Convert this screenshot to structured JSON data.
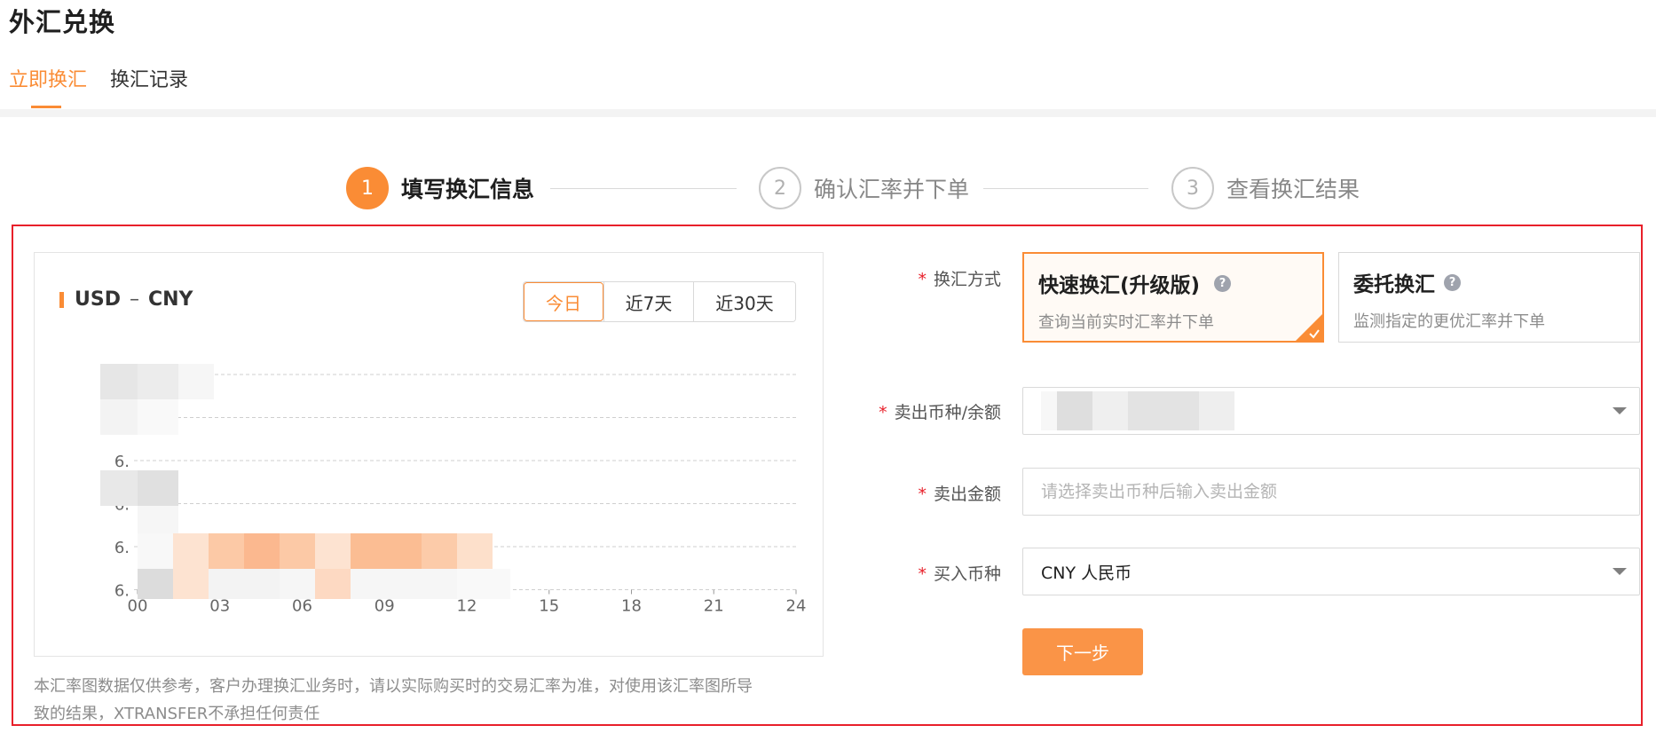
{
  "page": {
    "title": "外汇兑换"
  },
  "tabs": [
    {
      "label": "立即换汇",
      "active": true
    },
    {
      "label": "换汇记录",
      "active": false
    }
  ],
  "steps": [
    {
      "num": "1",
      "label": "填写换汇信息",
      "active": true
    },
    {
      "num": "2",
      "label": "确认汇率并下单",
      "active": false
    },
    {
      "num": "3",
      "label": "查看换汇结果",
      "active": false
    }
  ],
  "chart": {
    "pair_from": "USD",
    "pair_sep": "–",
    "pair_to": "CNY",
    "periods": [
      {
        "label": "今日",
        "active": true
      },
      {
        "label": "近7天",
        "active": false
      },
      {
        "label": "近30天",
        "active": false
      }
    ]
  },
  "chart_data": {
    "type": "line",
    "x_ticks": [
      "00",
      "03",
      "06",
      "09",
      "12",
      "15",
      "18",
      "21",
      "24"
    ],
    "y_ticks": [
      "6.",
      "6.",
      "6.",
      "6.",
      "6.",
      "6."
    ],
    "grid": true,
    "note": "data values obscured (pixelated) in source"
  },
  "disclaimer": {
    "line1": "本汇率图数据仅供参考，客户办理换汇业务时，请以实际购买时的交易汇率为准，对使用该汇率图所导",
    "line2": "致的结果，XTRANSFER不承担任何责任"
  },
  "form": {
    "method_label": "换汇方式",
    "methods": [
      {
        "title": "快速换汇(升级版)",
        "desc": "查询当前实时汇率并下单",
        "selected": true
      },
      {
        "title": "委托换汇",
        "desc": "监测指定的更优汇率并下单",
        "selected": false
      }
    ],
    "sell_currency_label": "卖出币种/余额",
    "sell_amount_label": "卖出金额",
    "sell_amount_placeholder": "请选择卖出币种后输入卖出金额",
    "buy_currency_label": "买入币种",
    "buy_currency_value": "CNY 人民币",
    "next_label": "下一步",
    "required_mark": "*"
  },
  "colors": {
    "accent": "#fa8c35",
    "outline_red": "#e8202a"
  }
}
